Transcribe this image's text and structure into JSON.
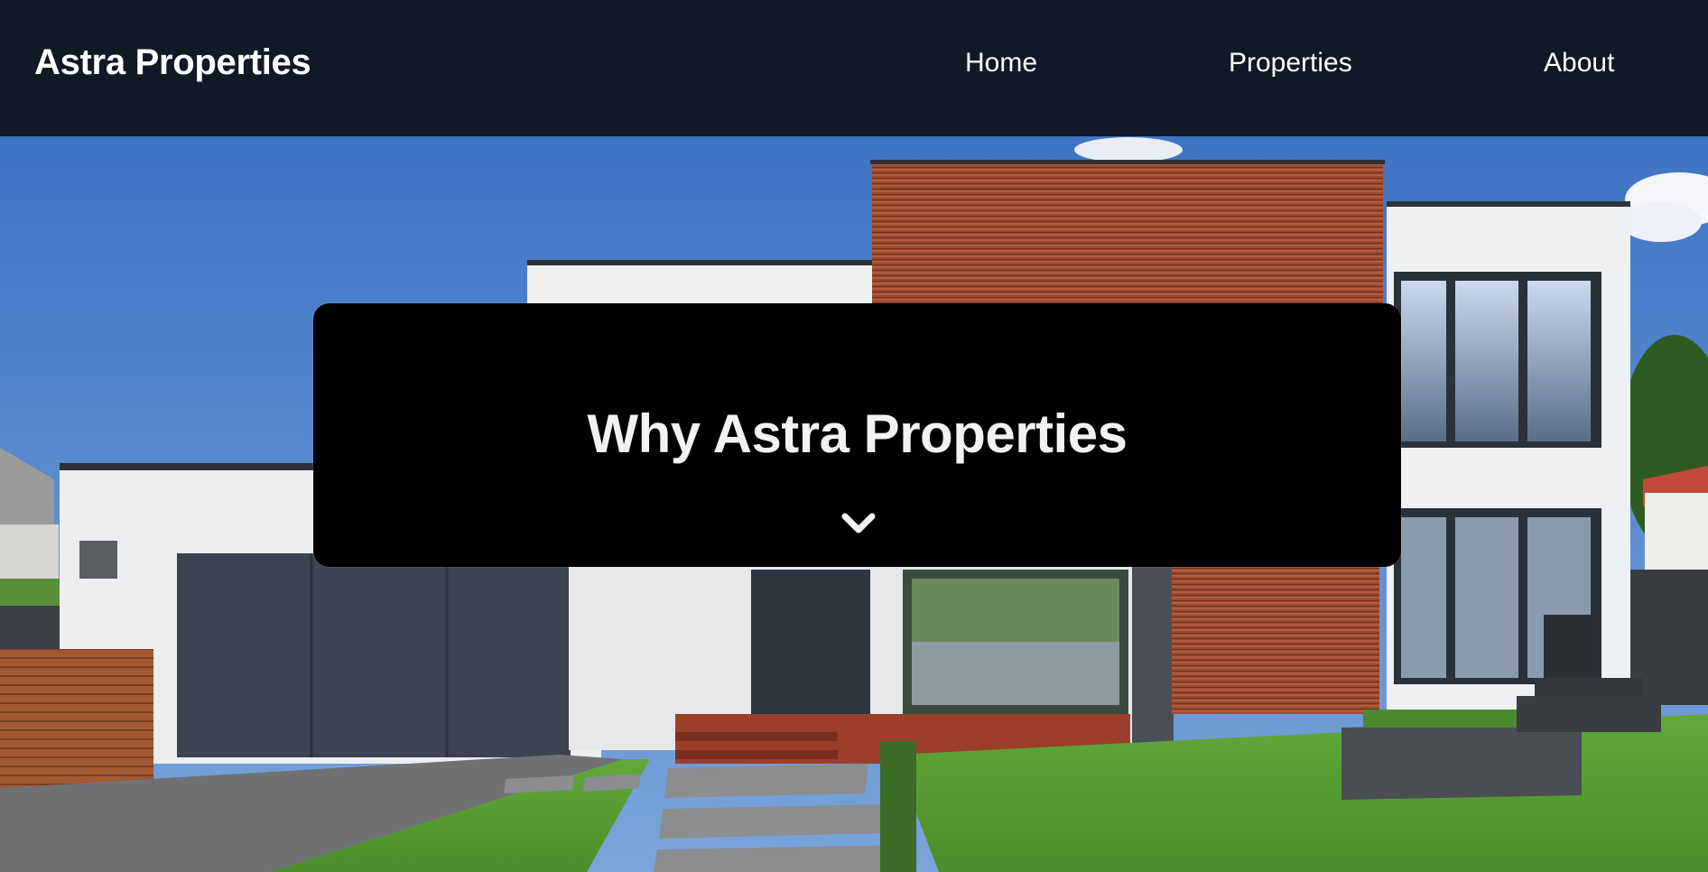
{
  "header": {
    "brand": "Astra Properties",
    "nav": [
      {
        "label": "Home"
      },
      {
        "label": "Properties"
      },
      {
        "label": "About"
      }
    ],
    "background": "#111826"
  },
  "hero": {
    "title": "Why Astra Properties",
    "scroll_icon": "chevron-down-icon",
    "image": "modern-house-photo"
  },
  "colors": {
    "header_bg": "#111826",
    "card_bg": "#000000",
    "text": "#ffffff"
  }
}
